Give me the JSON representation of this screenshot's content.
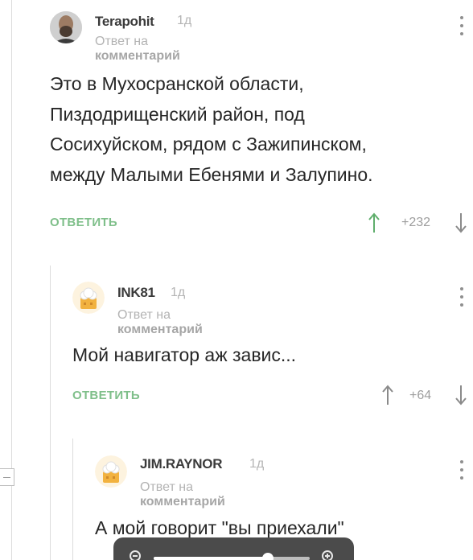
{
  "comments": [
    {
      "author": "Terapohit",
      "age": "1д",
      "reply_to_prefix": "Ответ на",
      "reply_to_target": "комментарий",
      "text": "Это в Мухосранской области,\nПиздодрищенский район, под\nСосихуйском, рядом с Зажипинском,\nмежду Малыми Ебенями и Залупино.",
      "reply_label": "ОТВЕТИТЬ",
      "rating": "+232",
      "avatar": "user-photo"
    },
    {
      "author": "INK81",
      "age": "1д",
      "reply_to_prefix": "Ответ на",
      "reply_to_target": "комментарий",
      "text": "Мой навигатор аж завис...",
      "reply_label": "ОТВЕТИТЬ",
      "rating": "+64",
      "avatar": "default-chef-avatar"
    },
    {
      "author": "JIM.RAYNOR",
      "age": "1д",
      "reply_to_prefix": "Ответ на",
      "reply_to_target": "комментарий",
      "text": "А мой говорит \"вы приехали\"",
      "avatar": "default-chef-avatar"
    }
  ],
  "icons": {
    "vote_up": "arrow-up-icon",
    "vote_down": "arrow-down-icon",
    "more": "vertical-dots-icon",
    "zoom_out": "zoom-out-icon",
    "zoom_in": "zoom-in-icon"
  },
  "zoom": {
    "level_fraction": 0.73
  },
  "colors": {
    "accent_green": "#7fbf8a",
    "zoom_bar_bg": "#4b4b4b",
    "text": "#262626",
    "muted": "#b3b3b3"
  }
}
